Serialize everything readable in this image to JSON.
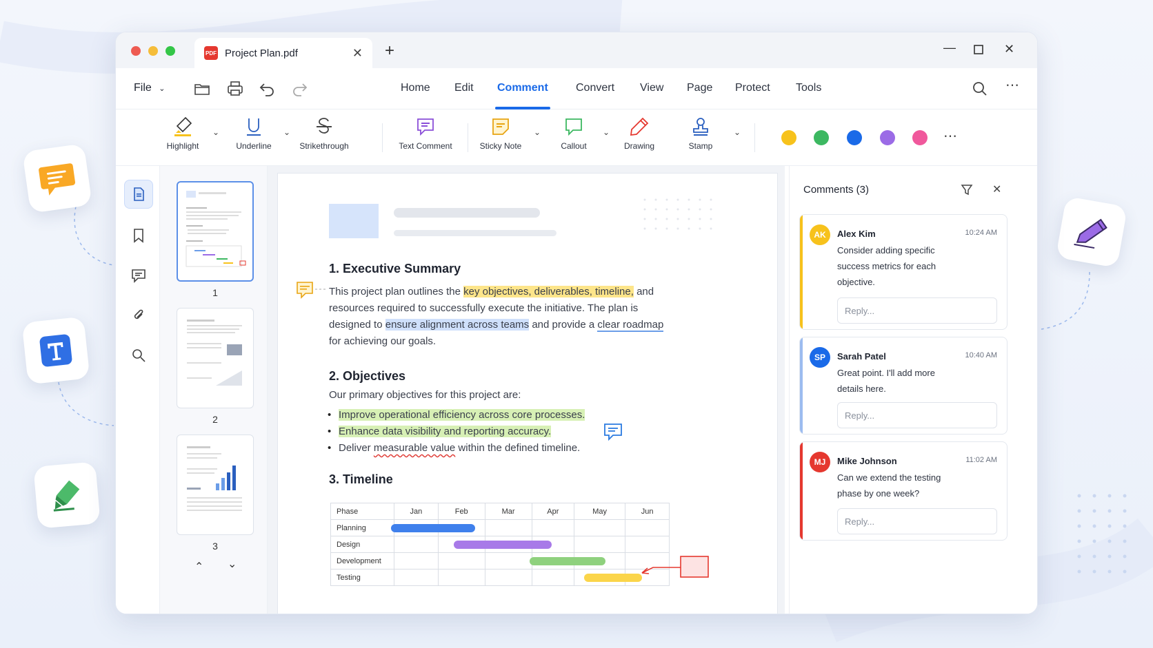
{
  "tab": {
    "title": "Project Plan.pdf",
    "icon_text": "PDF"
  },
  "menu": {
    "file": "File",
    "items": [
      "Home",
      "Edit",
      "Comment",
      "Convert",
      "View",
      "Page",
      "Protect",
      "Tools"
    ],
    "active": "Comment"
  },
  "ribbon": {
    "tools": [
      "Highlight",
      "Underline",
      "Strikethrough",
      "Text Comment",
      "Sticky Note",
      "Callout",
      "Drawing",
      "Stamp"
    ],
    "colors": [
      "#f7c21c",
      "#3cb861",
      "#1a6ae8",
      "#9b6be6",
      "#f0589c"
    ]
  },
  "thumbnails": {
    "pages": [
      "1",
      "2",
      "3"
    ]
  },
  "document": {
    "h1": "1. Executive Summary",
    "p1_a": "This project plan outlines the ",
    "p1_hl": "key objectives, deliverables, timeline,",
    "p1_b": " and",
    "p1_line2": "resources required to successfully execute the initiative. The plan is",
    "p1_line3_a": "designed to ",
    "p1_line3_hl": "ensure alignment across teams",
    "p1_line3_b": " and provide a ",
    "p1_line3_ul": "clear roadmap",
    "p1_line4": "for achieving our goals.",
    "h2": "2. Objectives",
    "p2": "Our primary objectives for this project are:",
    "b1": "Improve operational efficiency across core processes.",
    "b2": "Enhance data visibility and reporting accuracy.",
    "b3_a": "Deliver ",
    "b3_sq": "measurable value",
    "b3_b": " within the defined timeline.",
    "h3": "3. Timeline",
    "gantt": {
      "header": [
        "Phase",
        "Jan",
        "Feb",
        "Mar",
        "Apr",
        "May",
        "Jun"
      ],
      "rows": [
        "Planning",
        "Design",
        "Development",
        "Testing"
      ]
    }
  },
  "comments": {
    "title": "Comments (3)",
    "items": [
      {
        "initials": "AK",
        "name": "Alex Kim",
        "time": "10:24 AM",
        "text": "Consider adding specific success metrics for each objective.",
        "reply": "Reply...",
        "color": "#f7c21c"
      },
      {
        "initials": "SP",
        "name": "Sarah Patel",
        "time": "10:40 AM",
        "text": "Great point. I'll add more details here.",
        "reply": "Reply...",
        "color": "#1a6ae8"
      },
      {
        "initials": "MJ",
        "name": "Mike Johnson",
        "time": "11:02 AM",
        "text": "Can we extend the testing phase by one week?",
        "reply": "Reply...",
        "color": "#e5382f"
      }
    ]
  }
}
